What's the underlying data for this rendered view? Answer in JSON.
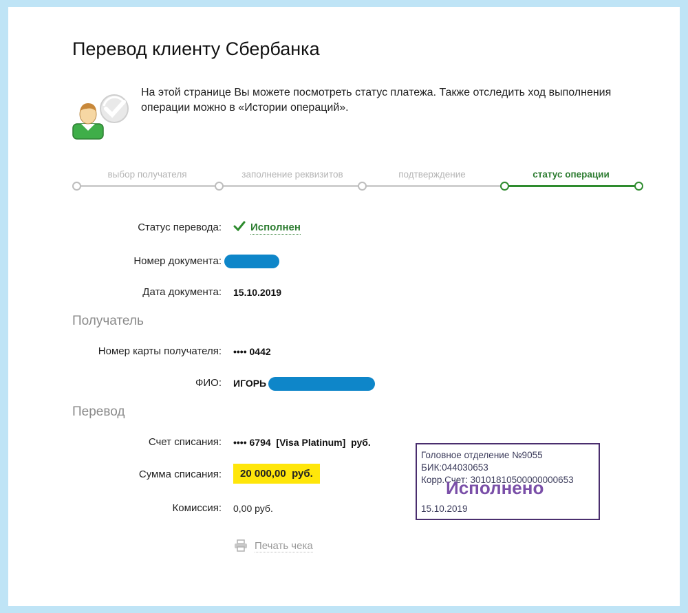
{
  "page": {
    "title": "Перевод клиенту Сбербанка",
    "info": "На этой странице Вы можете посмотреть статус платежа. Также отследить ход выполнения операции можно в «Истории операций»."
  },
  "steps": [
    {
      "label": "выбор получателя",
      "active": false
    },
    {
      "label": "заполнение реквизитов",
      "active": false
    },
    {
      "label": "подтверждение",
      "active": false
    },
    {
      "label": "статус операции",
      "active": true
    }
  ],
  "status": {
    "label": "Статус перевода:",
    "value": "Исполнен"
  },
  "document": {
    "number_label": "Номер документа:",
    "date_label": "Дата документа:",
    "date_value": "15.10.2019"
  },
  "recipient": {
    "section_title": "Получатель",
    "card_label": "Номер карты получателя:",
    "card_value": "•••• 0442",
    "name_label": "ФИО:",
    "name_value": "ИГОРЬ"
  },
  "transfer": {
    "section_title": "Перевод",
    "account_label": "Счет списания:",
    "account_value": "•••• 6794  [Visa Platinum]  руб.",
    "amount_label": "Сумма списания:",
    "amount_value": "20 000,00  руб.",
    "fee_label": "Комиссия:",
    "fee_value": "0,00 руб."
  },
  "print": {
    "label": "Печать чека",
    "icon": "printer-icon"
  },
  "stamp": {
    "line1": "Головное отделение №9055",
    "line2": "БИК:044030653",
    "line3": "Корр.Счет: 30101810500000000653",
    "big": "Исполнено",
    "date": "15.10.2019"
  },
  "colors": {
    "accent_green": "#2e7d32",
    "highlight_yellow": "#ffe60a",
    "redaction_blue": "#0e86c9",
    "stamp_purple": "#7a4fa8"
  }
}
